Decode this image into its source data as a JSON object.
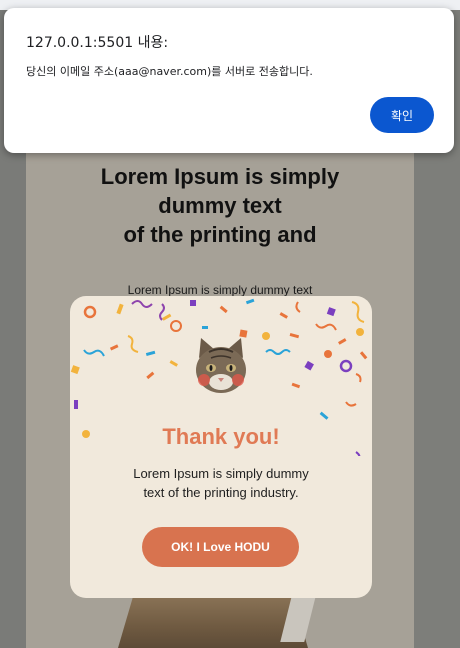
{
  "alert": {
    "title": "127.0.0.1:5501 내용:",
    "message": "당신의 이메일 주소(aaa@naver.com)를 서버로 전송합니다.",
    "ok_label": "확인"
  },
  "page": {
    "heading_lines": [
      "Lorem Ipsum is simply",
      "dummy text",
      "of the printing and"
    ],
    "subtext": "Lorem Ipsum is simply dummy text"
  },
  "modal": {
    "title": "Thank you!",
    "text": "Lorem Ipsum is simply dummy text of the printing industry.",
    "button_label": "OK! I Love HODU"
  },
  "colors": {
    "accent_orange": "#d8734f",
    "alert_button_blue": "#0b57d0",
    "modal_background": "#f1e9dc"
  },
  "icons": {
    "cat": "cat-face-icon",
    "confetti": "confetti-decoration"
  }
}
